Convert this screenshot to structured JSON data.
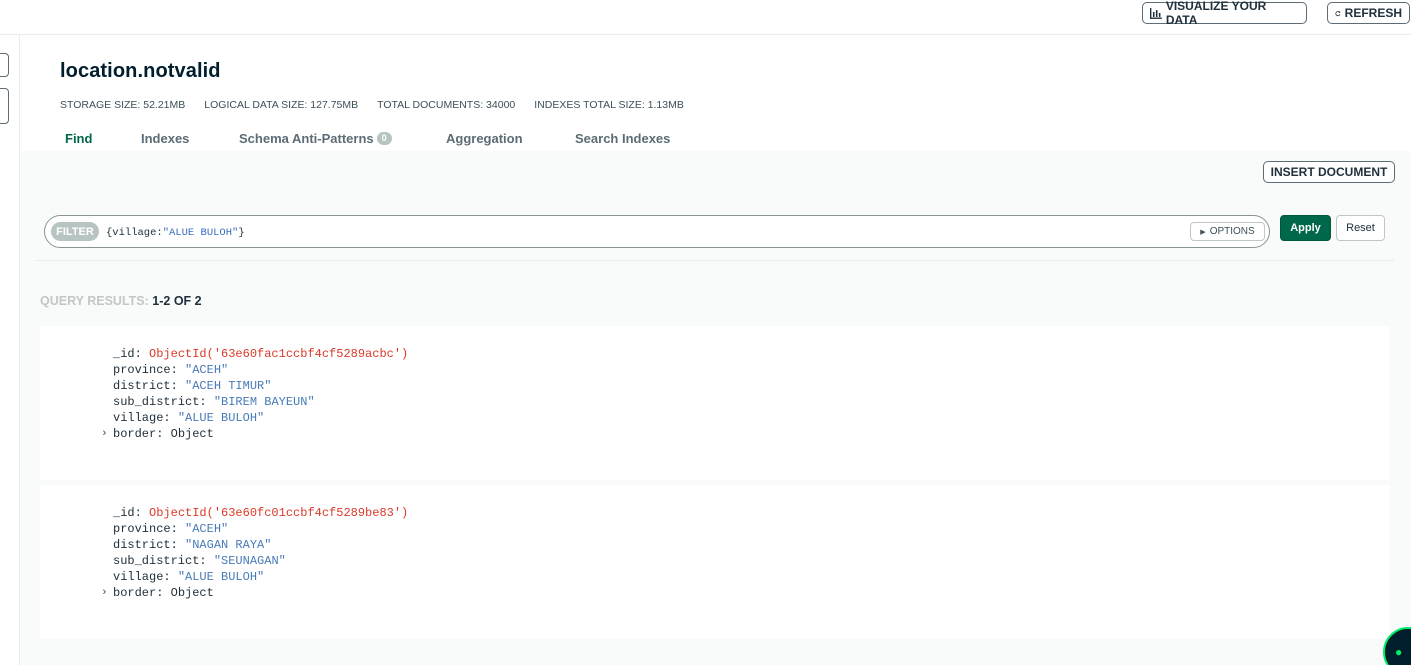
{
  "topbar": {
    "visualize_label": "VISUALIZE YOUR DATA",
    "refresh_label": "REFRESH"
  },
  "collection": {
    "title": "location.notvalid",
    "stats": [
      "STORAGE SIZE: 52.21MB",
      "LOGICAL DATA SIZE: 127.75MB",
      "TOTAL DOCUMENTS: 34000",
      "INDEXES TOTAL SIZE: 1.13MB"
    ]
  },
  "tabs": [
    {
      "label": "Find",
      "active": true
    },
    {
      "label": "Indexes",
      "active": false
    },
    {
      "label": "Schema Anti-Patterns",
      "badge": "0",
      "active": false
    },
    {
      "label": "Aggregation",
      "active": false
    },
    {
      "label": "Search Indexes",
      "active": false
    }
  ],
  "toolbar": {
    "insert_label": "INSERT DOCUMENT"
  },
  "filter": {
    "label": "FILTER",
    "query_key": "{village:",
    "query_value": "\"ALUE BULOH\"",
    "query_end": "}",
    "options_label": "OPTIONS",
    "apply_label": "Apply",
    "reset_label": "Reset"
  },
  "results": {
    "label": "QUERY RESULTS:",
    "count": "1-2 OF 2"
  },
  "documents": [
    {
      "_id": "ObjectId('63e60fac1ccbf4cf5289acbc')",
      "province": "\"ACEH\"",
      "district": "\"ACEH TIMUR\"",
      "sub_district": "\"BIREM BAYEUN\"",
      "village": "\"ALUE BULOH\"",
      "border": "Object"
    },
    {
      "_id": "ObjectId('63e60fc01ccbf4cf5289be83')",
      "province": "\"ACEH\"",
      "district": "\"NAGAN RAYA\"",
      "sub_district": "\"SEUNAGAN\"",
      "village": "\"ALUE BULOH\"",
      "border": "Object"
    }
  ],
  "field_keys": {
    "id": "_id:",
    "province": "province:",
    "district": "district:",
    "sub_district": "sub_district:",
    "village": "village:",
    "border": "border:"
  },
  "colors": {
    "accent_green": "#00684a",
    "objectid_red": "#db3928",
    "string_blue": "#1a5aa6"
  }
}
